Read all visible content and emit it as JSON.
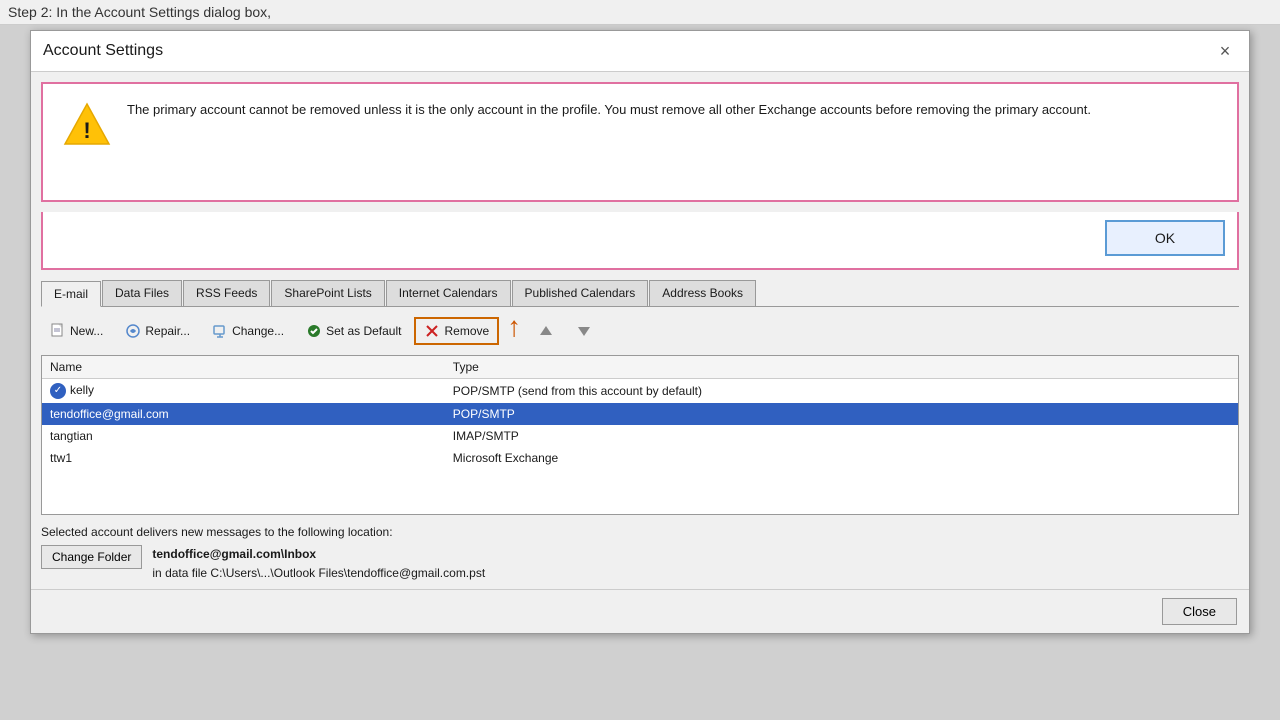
{
  "background": {
    "instruction_text": "Step 2: In the Account Settings dialog box,"
  },
  "dialog": {
    "title": "Account Settings",
    "close_label": "×"
  },
  "warning": {
    "message": "The primary account cannot be removed unless it is the only account in the profile. You must remove all other Exchange accounts before removing the primary account."
  },
  "ok_button": {
    "label": "OK"
  },
  "tabs": [
    {
      "id": "email",
      "label": "E-mail",
      "active": true
    },
    {
      "id": "data-files",
      "label": "Data Files"
    },
    {
      "id": "rss-feeds",
      "label": "RSS Feeds"
    },
    {
      "id": "sharepoint",
      "label": "SharePoint Lists"
    },
    {
      "id": "internet-cal",
      "label": "Internet Calendars"
    },
    {
      "id": "published-cal",
      "label": "Published Calendars"
    },
    {
      "id": "address-books",
      "label": "Address Books"
    }
  ],
  "toolbar": {
    "new_label": "New...",
    "repair_label": "Repair...",
    "change_label": "Change...",
    "set_default_label": "Set as Default",
    "remove_label": "Remove",
    "move_up_label": "▲",
    "move_down_label": "▼"
  },
  "table": {
    "headers": [
      "Name",
      "Type"
    ],
    "rows": [
      {
        "name": "kelly",
        "type": "POP/SMTP (send from this account by default)",
        "default": true,
        "selected": false
      },
      {
        "name": "tendoffice@gmail.com",
        "type": "POP/SMTP",
        "default": false,
        "selected": true
      },
      {
        "name": "tangtian",
        "type": "IMAP/SMTP",
        "default": false,
        "selected": false
      },
      {
        "name": "ttw1",
        "type": "Microsoft Exchange",
        "default": false,
        "selected": false
      }
    ]
  },
  "bottom": {
    "description": "Selected account delivers new messages to the following location:",
    "change_folder_label": "Change Folder",
    "folder_name": "tendoffice@gmail.com\\Inbox",
    "folder_path": "in data file C:\\Users\\...\\Outlook Files\\tendoffice@gmail.com.pst"
  },
  "footer": {
    "close_label": "Close"
  }
}
